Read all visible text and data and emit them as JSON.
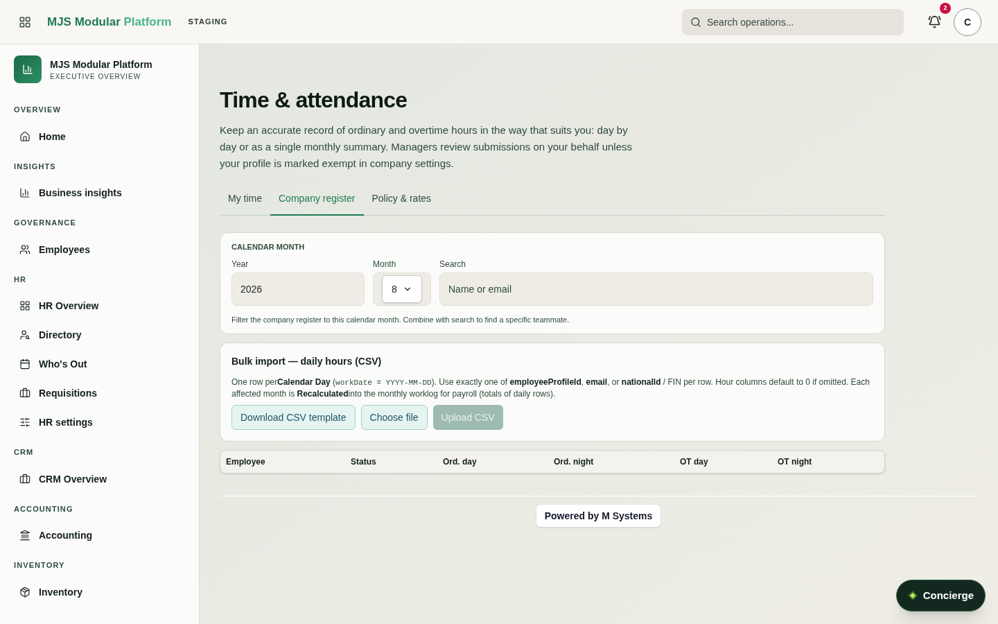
{
  "topbar": {
    "brand_main": "MJS Modular",
    "brand_accent": "Platform",
    "environment": "STAGING",
    "search": {
      "placeholder": "Search operations..."
    },
    "notifications": "2",
    "avatar": "C"
  },
  "sidebar": {
    "title": "MJS Modular Platform",
    "subtitle": "EXECUTIVE OVERVIEW",
    "sections": [
      {
        "heading": "OVERVIEW",
        "items": [
          {
            "label": "Home",
            "selected": false
          }
        ]
      },
      {
        "heading": "INSIGHTS",
        "items": [
          {
            "label": "Business insights",
            "selected": false
          }
        ]
      },
      {
        "heading": "GOVERNANCE",
        "items": [
          {
            "label": "Employees",
            "selected": false
          }
        ]
      },
      {
        "heading": "HR",
        "items": [
          {
            "label": "HR Overview",
            "selected": false
          },
          {
            "label": "Directory",
            "selected": false
          },
          {
            "label": "Who's Out",
            "selected": false
          },
          {
            "label": "Requisitions",
            "selected": false
          },
          {
            "label": "HR settings",
            "selected": false
          }
        ]
      },
      {
        "heading": "CRM",
        "items": [
          {
            "label": "CRM Overview",
            "selected": false
          }
        ]
      },
      {
        "heading": "ACCOUNTING",
        "items": [
          {
            "label": "Accounting",
            "selected": false
          }
        ]
      },
      {
        "heading": "INVENTORY",
        "items": [
          {
            "label": "Inventory",
            "selected": false
          }
        ]
      }
    ]
  },
  "page": {
    "title": "Time & attendance",
    "description": "Keep an accurate record of ordinary and overtime hours in the way that suits you: day by day or as a single monthly summary. Managers review submissions on your behalf unless your profile is marked exempt in company settings.",
    "tabs": [
      {
        "label": "My time",
        "selected": false
      },
      {
        "label": "Company register",
        "selected": true
      },
      {
        "label": "Policy & rates",
        "selected": false
      }
    ],
    "filter": {
      "heading": "CALENDAR MONTH",
      "year_label": "Year",
      "year": "2026",
      "month_label": "Month",
      "month": "8",
      "search_label": "Search",
      "search_placeholder": "Name or email",
      "hint": "Filter the company register to this calendar month. Combine with search to find a specific teammate."
    },
    "bulk": {
      "title": "Bulk import — daily hours (CSV)",
      "description": [
        {
          "kind": "plain",
          "text": "One row per"
        },
        {
          "kind": "bold",
          "text": "Calendar Day"
        },
        {
          "kind": "plain",
          "text": " ("
        },
        {
          "kind": "code",
          "text": "workDate = YYYY-MM-DD"
        },
        {
          "kind": "plain",
          "text": "). Use exactly one of "
        },
        {
          "kind": "bold",
          "text": "employeeProfileId"
        },
        {
          "kind": "plain",
          "text": ", "
        },
        {
          "kind": "bold",
          "text": "email"
        },
        {
          "kind": "plain",
          "text": ", or "
        },
        {
          "kind": "bold",
          "text": "nationalId"
        },
        {
          "kind": "plain",
          "text": " / FIN per row. Hour columns default to 0 if omitted. Each affected month is "
        },
        {
          "kind": "bold",
          "text": "Recalculated"
        },
        {
          "kind": "plain",
          "text": "into the monthly worklog for payroll (totals of daily rows)."
        }
      ],
      "buttons": [
        {
          "label": "Download CSV template",
          "disabled": false
        },
        {
          "label": "Choose file",
          "disabled": false
        },
        {
          "label": "Upload CSV",
          "disabled": true
        }
      ]
    },
    "table": {
      "columns": [
        "Employee",
        "Status",
        "Ord. day",
        "Ord. night",
        "OT day",
        "OT night"
      ]
    },
    "footer": "Powered by M Systems",
    "concierge": "Concierge"
  }
}
